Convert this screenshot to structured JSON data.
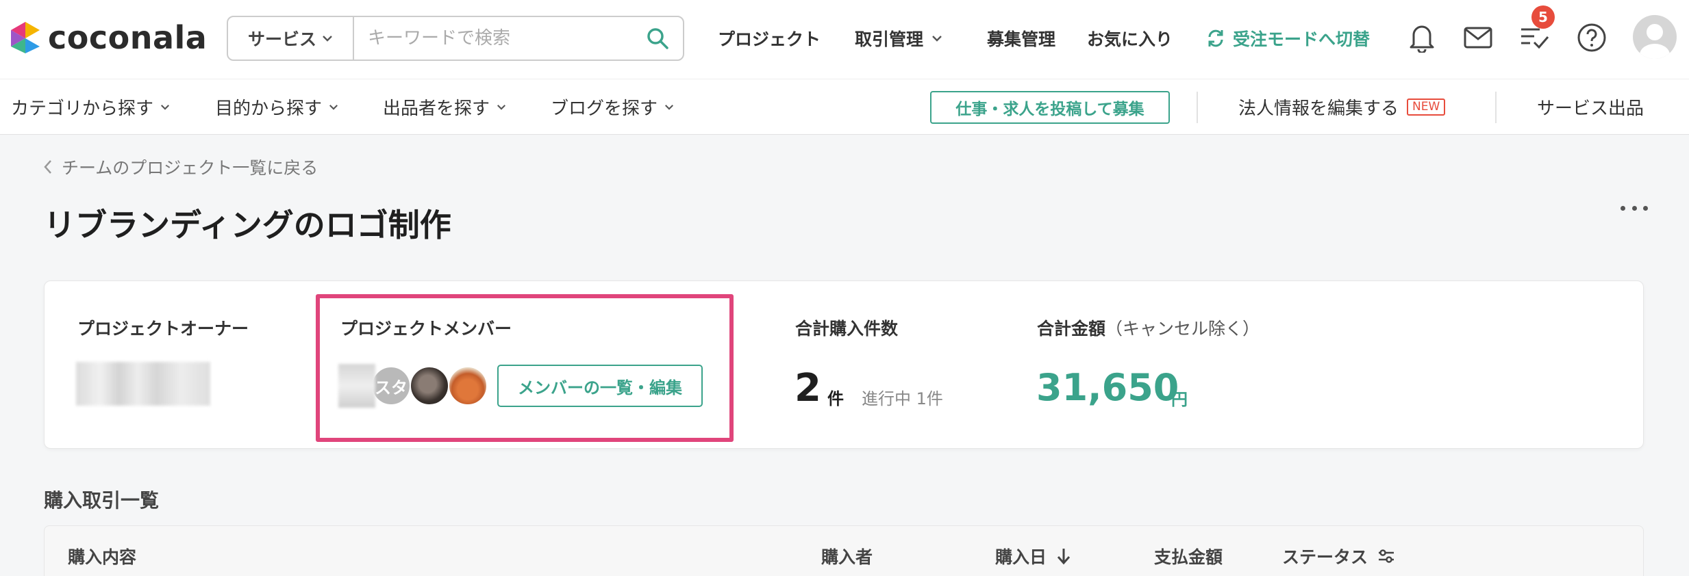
{
  "header": {
    "logo_text": "coconala",
    "search": {
      "category": "サービス",
      "placeholder": "キーワードで検索",
      "value": ""
    },
    "nav": {
      "project": "プロジェクト",
      "transactions": "取引管理",
      "recruit": "募集管理",
      "favorites": "お気に入り",
      "switch_mode": "受注モードへ切替"
    },
    "todo_badge_count": "5"
  },
  "subheader": {
    "category": "カテゴリから探す",
    "purpose": "目的から探す",
    "sellers": "出品者を探す",
    "blog": "ブログを探す",
    "post_job": "仕事・求人を投稿して募集",
    "corp_info": "法人情報を編集する",
    "new_badge": "NEW",
    "sell_service": "サービス出品"
  },
  "page": {
    "back_link": "チームのプロジェクト一覧に戻る",
    "title": "リブランディングのロゴ制作"
  },
  "summary": {
    "owner_label": "プロジェクトオーナー",
    "members_label": "プロジェクトメンバー",
    "member_avatar_text": "スタ",
    "members_button": "メンバーの一覧・編集",
    "purchase_count_label": "合計購入件数",
    "purchase_count": "2",
    "purchase_count_unit": "件",
    "in_progress": "進行中 1件",
    "total_amount_label": "合計金額",
    "total_amount_note": "（キャンセル除く）",
    "total_amount": "31,650",
    "total_amount_unit": "円"
  },
  "transactions": {
    "section_title": "購入取引一覧",
    "columns": {
      "content": "購入内容",
      "buyer": "購入者",
      "date": "購入日",
      "amount": "支払金額",
      "status": "ステータス"
    }
  },
  "colors": {
    "accent": "#3ba38b",
    "highlight": "#e0457b",
    "badge": "#e74c3c"
  }
}
